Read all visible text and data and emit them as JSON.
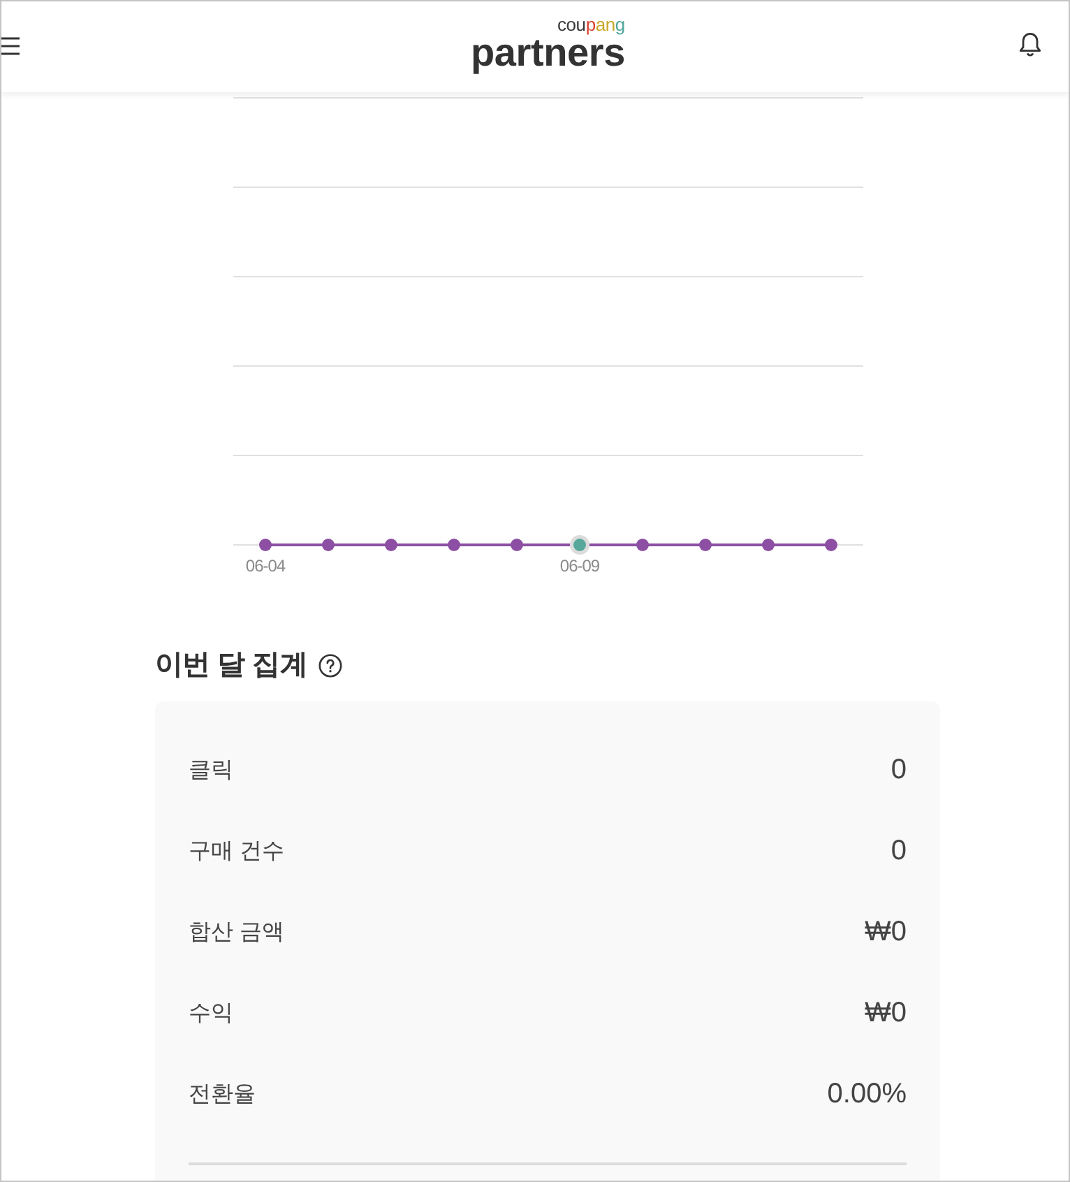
{
  "header": {
    "logo": {
      "brand_parts": [
        {
          "text": "cou",
          "color": "#3a3a3a"
        },
        {
          "text": "p",
          "color": "#d9402f"
        },
        {
          "text": "an",
          "color": "#c9a72a"
        },
        {
          "text": "g",
          "color": "#4ea59b"
        }
      ],
      "name": "partners"
    }
  },
  "chart": {
    "points": [
      {
        "label": "06-04",
        "selected": false
      },
      {
        "selected": false
      },
      {
        "selected": false
      },
      {
        "selected": false
      },
      {
        "selected": false
      },
      {
        "label": "06-09",
        "selected": true
      },
      {
        "selected": false
      },
      {
        "selected": false
      },
      {
        "selected": false
      },
      {
        "selected": false
      }
    ]
  },
  "summary": {
    "title": "이번 달 집계",
    "rows": [
      {
        "label": "클릭",
        "value": "0"
      },
      {
        "label": "구매 건수",
        "value": "0"
      },
      {
        "label": "합산 금액",
        "value": "₩0"
      },
      {
        "label": "수익",
        "value": "₩0"
      },
      {
        "label": "전환율",
        "value": "0.00%"
      }
    ]
  }
}
